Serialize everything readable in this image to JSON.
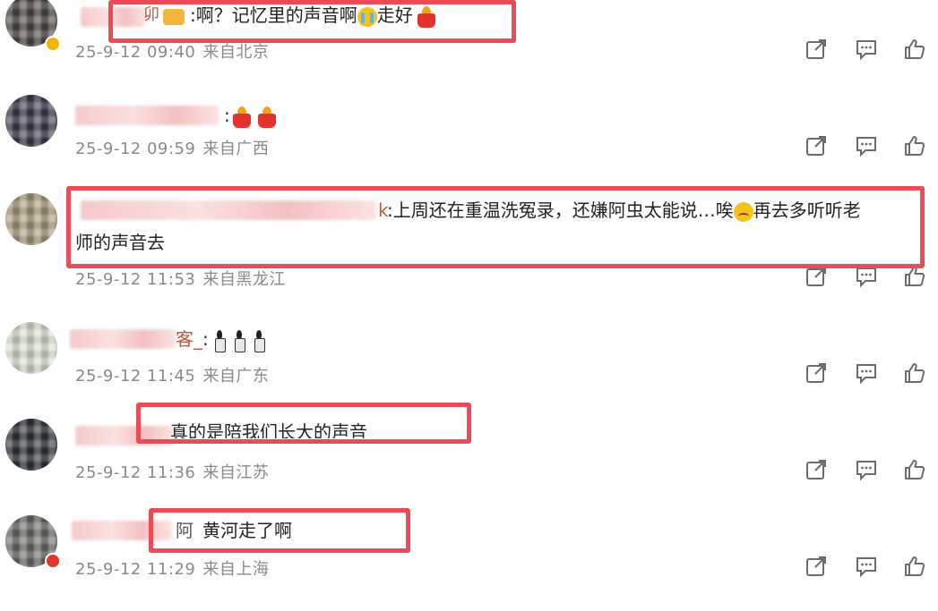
{
  "colors": {
    "highlight_box": "#ea4c57",
    "meta_text": "#8a8a8a",
    "icon": "#6b6b6b"
  },
  "comments": [
    {
      "name_visible": "卯",
      "text": ":啊？记忆里的声音啊",
      "text_tail": "走好",
      "time": "25-9-12 09:40",
      "region": "来自北京",
      "avatar_color": "#4a4740",
      "badge_color": "#f2b600",
      "emoji": [
        "crown-icon",
        "crying-face-icon",
        "red-candle-icon"
      ]
    },
    {
      "name_visible": "",
      "text": ":",
      "time": "25-9-12 09:59",
      "region": "来自广西",
      "avatar_color": "#3d3a4a",
      "emoji": [
        "red-candle-icon",
        "red-candle-icon"
      ]
    },
    {
      "name_visible": "k",
      "text": ":上周还在重温洗冤录，还嫌阿虫太能说…唉",
      "text_tail": "再去多听听老",
      "text_line2": "师的声音去",
      "time": "25-9-12 11:53",
      "region": "来自黑龙江",
      "avatar_color": "#a99a7c",
      "emoji": [
        "sad-face-icon"
      ]
    },
    {
      "name_visible": "客_",
      "text": ":",
      "time": "25-9-12 11:45",
      "region": "来自广东",
      "avatar_color": "#d9e2d0",
      "emoji": [
        "black-candle-icon",
        "black-candle-icon",
        "black-candle-icon"
      ]
    },
    {
      "name_visible": "",
      "text": "真的是陪我们长大的声音",
      "time": "25-9-12 11:36",
      "region": "来自江苏",
      "avatar_color": "#2f3338"
    },
    {
      "name_visible": "阿",
      "text": "黄河走了啊",
      "time": "25-9-12 11:29",
      "region": "来自上海",
      "avatar_color": "#6c6a67",
      "badge_color": "#e2362c"
    }
  ],
  "actions": {
    "share_icon": "share-icon",
    "reply_icon": "comment-icon",
    "like_icon": "thumbs-up-icon"
  }
}
